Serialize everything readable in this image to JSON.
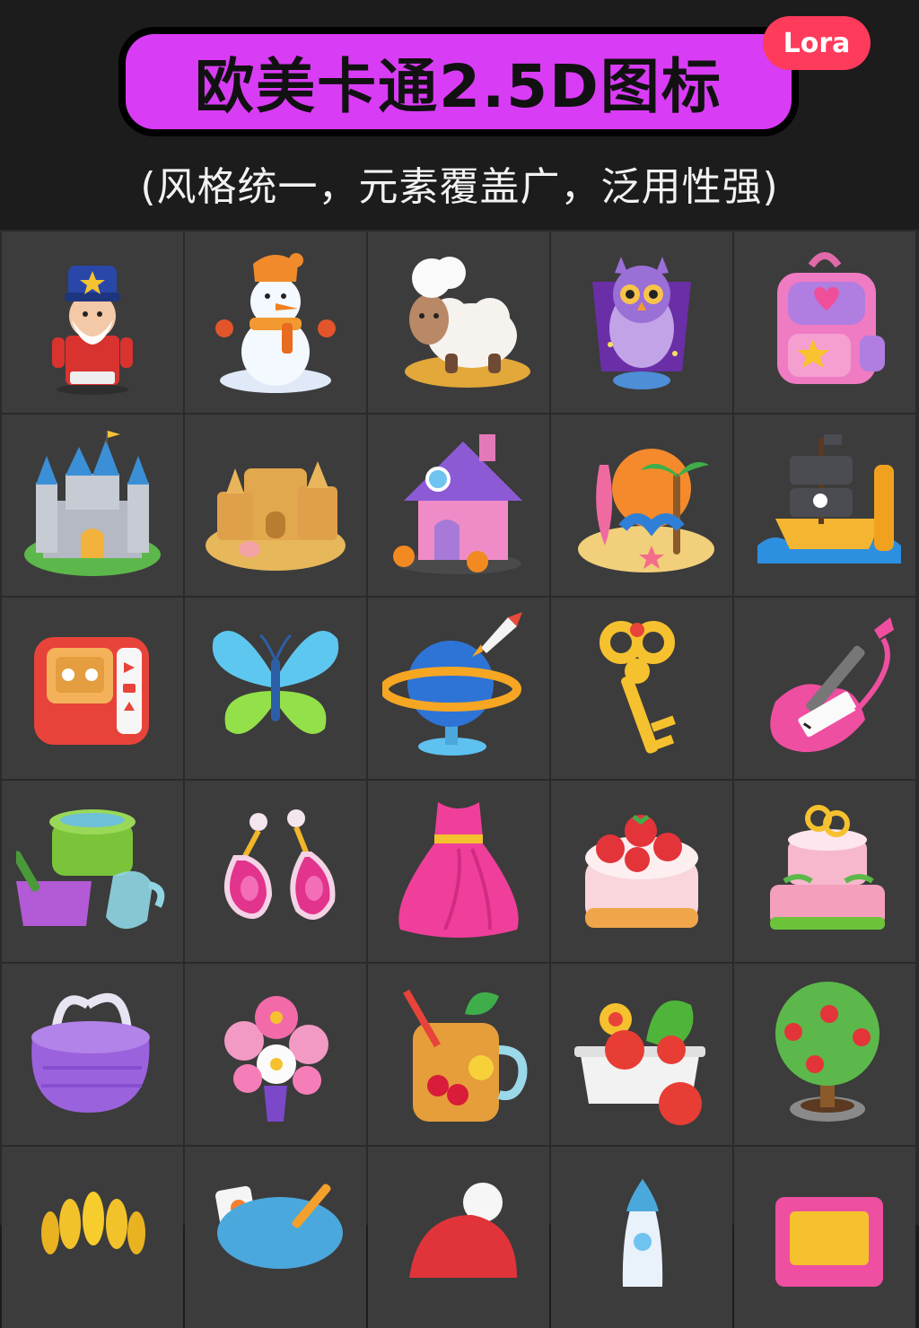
{
  "header": {
    "title": "欧美卡通2.5D图标",
    "badge": "Lora",
    "subtitle": "(风格统一，元素覆盖广，泛用性强)"
  },
  "icons": [
    "nutcracker-icon",
    "snowman-icon",
    "sheep-icon",
    "owl-icon",
    "backpack-icon",
    "castle-icon",
    "sandcastle-icon",
    "house-icon",
    "beach-island-icon",
    "pirate-ship-icon",
    "cassette-player-icon",
    "butterfly-icon",
    "globe-rocket-icon",
    "key-icon",
    "keytar-guitar-icon",
    "cooking-pot-icon",
    "earrings-icon",
    "dress-icon",
    "strawberry-cake-icon",
    "layer-cake-icon",
    "knit-basket-icon",
    "flower-bouquet-icon",
    "juice-jar-icon",
    "salad-box-icon",
    "apple-tree-icon",
    "wheat-icon",
    "paint-palette-icon",
    "beanie-hat-icon",
    "rocket-icon",
    "pink-box-icon"
  ],
  "colors": {
    "title_bg": "#d93cf5",
    "badge_bg": "#ff3b5c",
    "cell_bg": "#3c3c3c",
    "page_bg": "#1c1c1c"
  }
}
